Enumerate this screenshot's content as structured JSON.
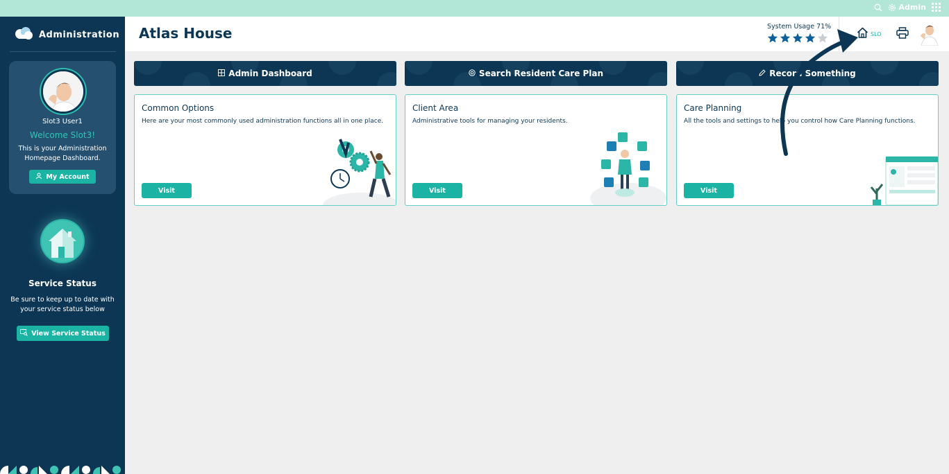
{
  "topbar": {
    "admin_label": "Admin"
  },
  "sidebar": {
    "brand": "Administration",
    "user_name": "Slot3 User1",
    "welcome": "Welcome Slot3!",
    "intro": "This is your Administration Homepage Dashboard.",
    "my_account": "My Account",
    "service_title": "Service Status",
    "service_text": "Be sure to keep up to date with your service status below",
    "view_service": "View Service Status"
  },
  "header": {
    "title": "Atlas House",
    "usage_label": "System Usage 71%",
    "usage_percent": 71,
    "stars_filled": 4,
    "stars_total": 5,
    "home_label": "SLO"
  },
  "actions": [
    {
      "label": "Admin Dashboard",
      "icon": "grid-icon"
    },
    {
      "label": "Search Resident Care Plan",
      "icon": "at-icon"
    },
    {
      "label": "Record Something",
      "icon": "pencil-icon"
    }
  ],
  "cards": [
    {
      "title": "Common Options",
      "desc": "Here are your most commonly used administration functions all in one place.",
      "button": "Visit"
    },
    {
      "title": "Client Area",
      "desc": "Administrative tools for managing your residents.",
      "button": "Visit"
    },
    {
      "title": "Care Planning",
      "desc": "All the tools and settings to help you control how Care Planning functions.",
      "button": "Visit"
    }
  ],
  "colors": {
    "navy": "#0c3654",
    "teal": "#1bb3a3",
    "mint": "#b2e6d7",
    "star": "#0d5f9c"
  }
}
